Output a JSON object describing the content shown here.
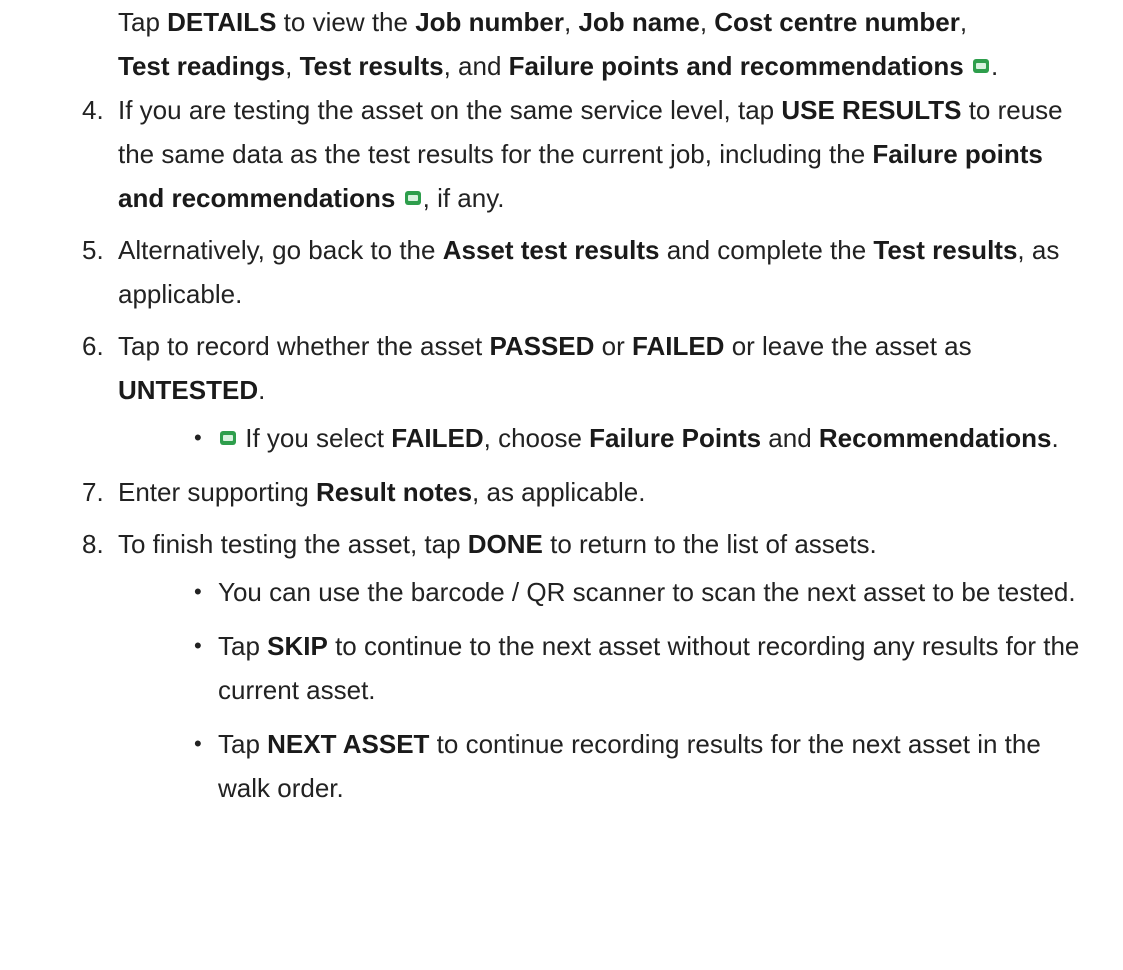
{
  "intro": {
    "t1": "Tap ",
    "details": "DETAILS",
    "t2": " to view the ",
    "job_number": "Job number",
    "t3": ", ",
    "job_name": "Job name",
    "t4": ", ",
    "cost_centre": "Cost centre number",
    "t5": ",",
    "test_readings": "Test readings",
    "t6": ", ",
    "test_results": "Test results",
    "t7": ", and ",
    "failure_points": "Failure points and recommendations",
    "t8": "."
  },
  "badge_icon": "mp-badge-icon",
  "accent_color": "#2e9e4c",
  "steps": [
    {
      "num": "4.",
      "a": "If you are testing the asset on the same service level, tap ",
      "b1": "USE RESULTS",
      "c": " to reuse the same data as the test results for the current job, including the ",
      "b2": "Failure points and recommendations",
      "d": ", if any."
    },
    {
      "num": "5.",
      "a": "Alternatively, go back to the ",
      "b1": "Asset test results",
      "c": " and complete the ",
      "b2": "Test results",
      "d": ", as applicable."
    },
    {
      "num": "6.",
      "a": "Tap to record whether the asset ",
      "b1": "PASSED",
      "c": " or ",
      "b2": "FAILED",
      "d": " or leave the asset as ",
      "b3": "UNTESTED",
      "e": ".",
      "sub": {
        "bullet": "•",
        "a": " If you select ",
        "b1": "FAILED",
        "c": ", choose ",
        "b2": "Failure Points",
        "d": " and ",
        "b3": "Recommendations",
        "e": "."
      }
    },
    {
      "num": "7.",
      "a": "Enter supporting ",
      "b1": "Result notes",
      "c": ", as applicable."
    },
    {
      "num": "8.",
      "a": "To finish testing the asset, tap ",
      "b1": "DONE",
      "c": " to return to the list of assets.",
      "subs": [
        {
          "bullet": "•",
          "a": "You can use the barcode / QR scanner to scan the next asset to be tested."
        },
        {
          "bullet": "•",
          "a": "Tap ",
          "b1": "SKIP",
          "c": " to continue to the next asset without recording any results for the current asset."
        },
        {
          "bullet": "•",
          "a": "Tap ",
          "b1": "NEXT ASSET",
          "c": " to continue recording results for the next asset in the walk order."
        }
      ]
    }
  ]
}
